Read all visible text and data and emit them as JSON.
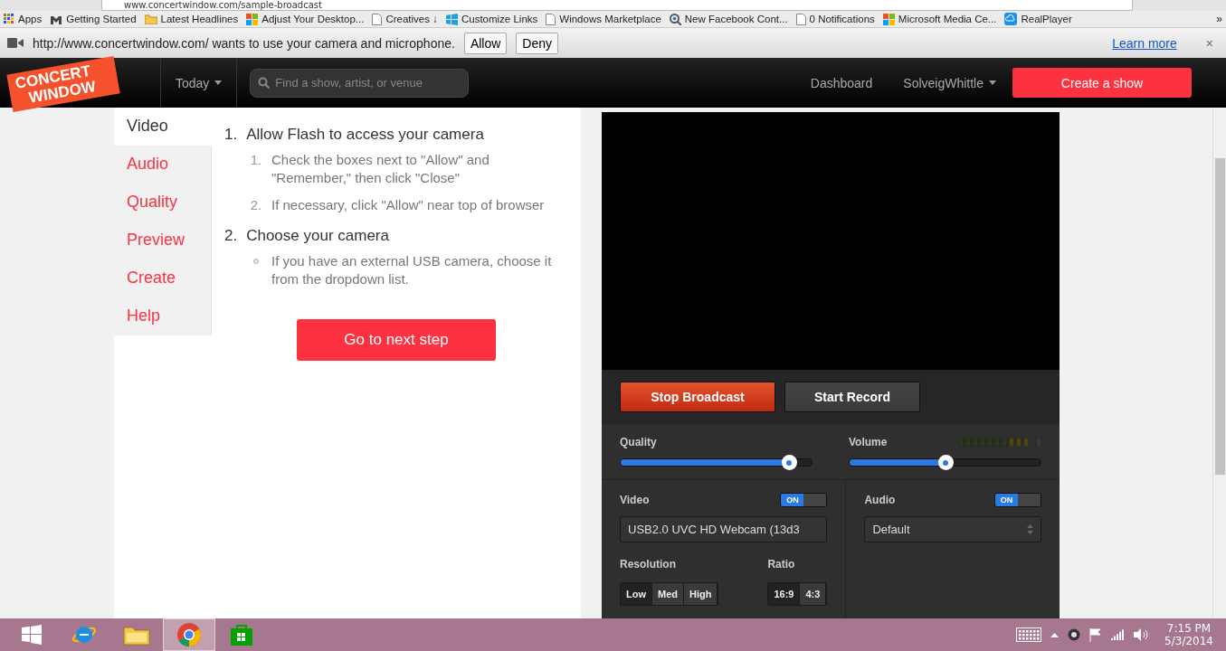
{
  "browser": {
    "url": "www.concertwindow.com/sample-broadcast",
    "bookmarks": [
      {
        "kind": "apps",
        "label": "Apps"
      },
      {
        "kind": "m",
        "label": "Getting Started"
      },
      {
        "kind": "folder",
        "label": "Latest Headlines"
      },
      {
        "kind": "ms",
        "label": "Adjust Your Desktop..."
      },
      {
        "kind": "page",
        "label": "Creatives ↓"
      },
      {
        "kind": "win",
        "label": "Customize Links"
      },
      {
        "kind": "page",
        "label": "Windows Marketplace"
      },
      {
        "kind": "lens",
        "label": "New Facebook Cont..."
      },
      {
        "kind": "page",
        "label": "0 Notifications"
      },
      {
        "kind": "ms",
        "label": "Microsoft Media Ce..."
      },
      {
        "kind": "real",
        "label": "RealPlayer"
      }
    ],
    "more": "»",
    "infobar": {
      "message": "http://www.concertwindow.com/ wants to use your camera and microphone.",
      "buttons": [
        "Allow",
        "Deny"
      ],
      "link": "Learn more",
      "close": "×"
    }
  },
  "site": {
    "logo": [
      "CONCERT",
      "WINDOW"
    ],
    "today": "Today",
    "search_placeholder": "Find a show, artist, or venue",
    "dashboard": "Dashboard",
    "user": "SolveigWhittle",
    "create": "Create a show"
  },
  "nav": [
    {
      "label": "Video",
      "selected": true
    },
    {
      "label": "Audio",
      "selected": false
    },
    {
      "label": "Quality",
      "selected": false
    },
    {
      "label": "Preview",
      "selected": false
    },
    {
      "label": "Create",
      "selected": false
    },
    {
      "label": "Help",
      "selected": false
    }
  ],
  "steps": [
    {
      "number": "1.",
      "title": "Allow Flash to access your camera",
      "children": [
        {
          "kind": "numbered",
          "number": "1.",
          "text": "Check the boxes next to \"Allow\" and \"Remember,\" then click \"Close\""
        },
        {
          "kind": "numbered",
          "number": "2.",
          "text": "If necessary, click \"Allow\" near top of browser"
        }
      ]
    },
    {
      "number": "2.",
      "title": "Choose your camera",
      "children": [
        {
          "kind": "bullet",
          "text": "If you have an external USB camera, choose it from the dropdown list."
        }
      ]
    }
  ],
  "next_button": "Go to next step",
  "broadcast": {
    "stop": "Stop Broadcast",
    "record": "Start Record",
    "quality": {
      "label": "Quality",
      "level": 0.88
    },
    "volume": {
      "label": "Volume",
      "level": 0.5
    },
    "video": {
      "label": "Video",
      "on": true,
      "toggle": "ON",
      "device": "USB2.0 UVC HD Webcam (13d3"
    },
    "audio": {
      "label": "Audio",
      "on": true,
      "toggle": "ON",
      "device": "Default"
    },
    "resolution": {
      "label": "Resolution",
      "options": [
        {
          "label": "Low",
          "selected": true
        },
        {
          "label": "Med",
          "selected": false
        },
        {
          "label": "High",
          "selected": false
        }
      ]
    },
    "ratio": {
      "label": "Ratio",
      "options": [
        {
          "label": "16:9",
          "selected": true
        },
        {
          "label": "4:3",
          "selected": false
        }
      ]
    }
  },
  "taskbar": {
    "apps": [
      {
        "kind": "start",
        "selected": false
      },
      {
        "kind": "ie",
        "selected": false
      },
      {
        "kind": "explorer",
        "selected": false
      },
      {
        "kind": "chrome",
        "selected": true
      },
      {
        "kind": "store",
        "selected": false
      }
    ],
    "time": "7:15 PM",
    "date": "5/3/2014"
  }
}
